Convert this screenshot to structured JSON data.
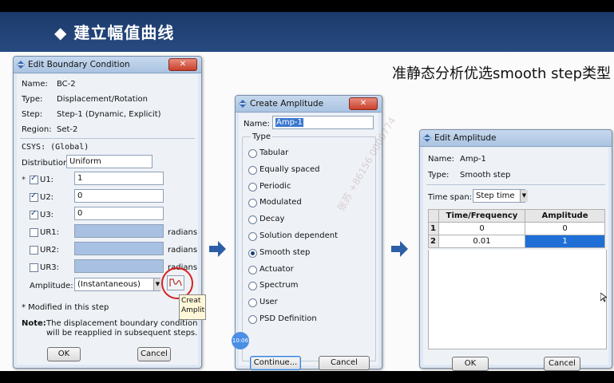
{
  "slide": {
    "title": "建立幅值曲线",
    "subtitle": "准静态分析优选smooth step类型"
  },
  "ebc": {
    "title": "Edit Boundary Condition",
    "name_label": "Name:",
    "name_value": "BC-2",
    "type_label": "Type:",
    "type_value": "Displacement/Rotation",
    "step_label": "Step:",
    "step_value": "Step-1 (Dynamic, Explicit)",
    "region_label": "Region:",
    "region_value": "Set-2",
    "csys": "CSYS: (Global)",
    "distribution_label": "Distribution:",
    "distribution_value": "Uniform",
    "u1_label": "U1:",
    "u1_value": "1",
    "u2_label": "U2:",
    "u2_value": "0",
    "u3_label": "U3:",
    "u3_value": "0",
    "ur1_label": "UR1:",
    "ur2_label": "UR2:",
    "ur3_label": "UR3:",
    "radians": "radians",
    "amplitude_label": "Amplitude:",
    "amplitude_value": "(Instantaneous)",
    "modified_note": "* Modified in this step",
    "note_label": "Note:",
    "note_text1": "The displacement boundary condition",
    "note_text2": "will be reapplied in subsequent steps.",
    "ok": "OK",
    "cancel": "Cancel",
    "tooltip1": "Creat",
    "tooltip2": "Amplitu"
  },
  "ca": {
    "title": "Create Amplitude",
    "name_label": "Name:",
    "name_value": "Amp-1",
    "type_label": "Type",
    "types": [
      "Tabular",
      "Equally spaced",
      "Periodic",
      "Modulated",
      "Decay",
      "Solution dependent",
      "Smooth step",
      "Actuator",
      "Spectrum",
      "User",
      "PSD Definition"
    ],
    "selected_index": 6,
    "continue": "Continue...",
    "cancel": "Cancel",
    "watermark": "张苏 +86156 0000774"
  },
  "ea": {
    "title": "Edit Amplitude",
    "name_label": "Name:",
    "name_value": "Amp-1",
    "type_label": "Type:",
    "type_value": "Smooth step",
    "timespan_label": "Time span:",
    "timespan_value": "Step time",
    "col1": "Time/Frequency",
    "col2": "Amplitude",
    "rows": [
      {
        "n": "1",
        "t": "0",
        "a": "0"
      },
      {
        "n": "2",
        "t": "0.01",
        "a": "1"
      }
    ],
    "ok": "OK",
    "cancel": "Cancel"
  },
  "timer_badge": "10:06",
  "colors": {
    "banner": "#1c3a6b",
    "selected_cell": "#1f6fd6",
    "highlight_circle": "#d62020"
  }
}
